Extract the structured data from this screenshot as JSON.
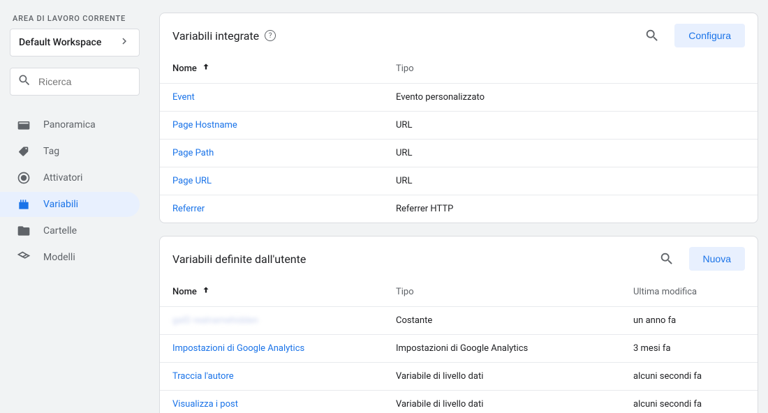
{
  "sidebar": {
    "workspace_label": "AREA DI LAVORO CORRENTE",
    "workspace_name": "Default Workspace",
    "search_placeholder": "Ricerca",
    "nav": {
      "overview": "Panoramica",
      "tags": "Tag",
      "triggers": "Attivatori",
      "variables": "Variabili",
      "folders": "Cartelle",
      "templates": "Modelli"
    }
  },
  "builtin": {
    "title": "Variabili integrate",
    "configure_label": "Configura",
    "cols": {
      "name": "Nome",
      "type": "Tipo"
    },
    "rows": [
      {
        "name": "Event",
        "type": "Evento personalizzato"
      },
      {
        "name": "Page Hostname",
        "type": "URL"
      },
      {
        "name": "Page Path",
        "type": "URL"
      },
      {
        "name": "Page URL",
        "type": "URL"
      },
      {
        "name": "Referrer",
        "type": "Referrer HTTP"
      }
    ]
  },
  "user": {
    "title": "Variabili definite dall'utente",
    "new_label": "Nuova",
    "cols": {
      "name": "Nome",
      "type": "Tipo",
      "modified": "Ultima modifica"
    },
    "rows": [
      {
        "name": "gaID realnamehidden",
        "type": "Costante",
        "modified": "un anno fa",
        "blurred": true
      },
      {
        "name": "Impostazioni di Google Analytics",
        "type": "Impostazioni di Google Analytics",
        "modified": "3 mesi fa"
      },
      {
        "name": "Traccia l'autore",
        "type": "Variabile di livello dati",
        "modified": "alcuni secondi fa"
      },
      {
        "name": "Visualizza i post",
        "type": "Variabile di livello dati",
        "modified": "alcuni secondi fa"
      }
    ]
  }
}
